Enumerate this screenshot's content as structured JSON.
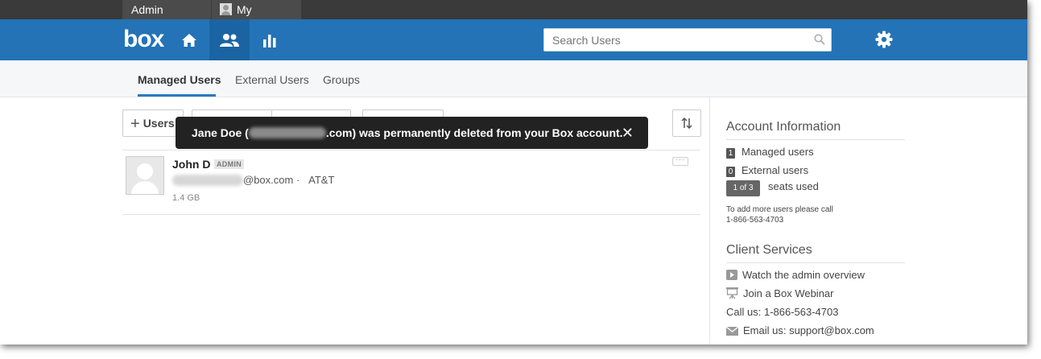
{
  "topbar": {
    "admin_console": "Admin Console",
    "my_account": "My Account"
  },
  "header": {
    "logo": "box",
    "search_placeholder": "Search Users",
    "accent_color": "#2373b6"
  },
  "tabs": [
    {
      "label": "Managed Users",
      "active": true
    },
    {
      "label": "External Users",
      "active": false
    },
    {
      "label": "Groups",
      "active": false
    }
  ],
  "toolbar": {
    "add_users_label": "Users"
  },
  "toast": {
    "prefix": "Jane Doe (",
    "suffix": ".com) was permanently deleted from your Box account.",
    "close": "✕"
  },
  "users": [
    {
      "name": "John D",
      "badge": "ADMIN",
      "email_domain": "@box.com",
      "separator": "·",
      "company": "AT&T",
      "storage": "1.4 GB",
      "menu": "···"
    }
  ],
  "account_info": {
    "title": "Account Information",
    "managed_count": "1",
    "managed_label": "Managed users",
    "external_count": "0",
    "external_label": "External users",
    "seats_badge": "1 of 3",
    "seats_label": "seats used",
    "add_more_line1": "To add more users please call",
    "add_more_line2": "1-866-563-4703"
  },
  "client_services": {
    "title": "Client Services",
    "watch": "Watch the admin overview",
    "webinar": "Join a Box Webinar",
    "call": "Call us: 1-866-563-4703",
    "email": "Email us: support@box.com"
  }
}
